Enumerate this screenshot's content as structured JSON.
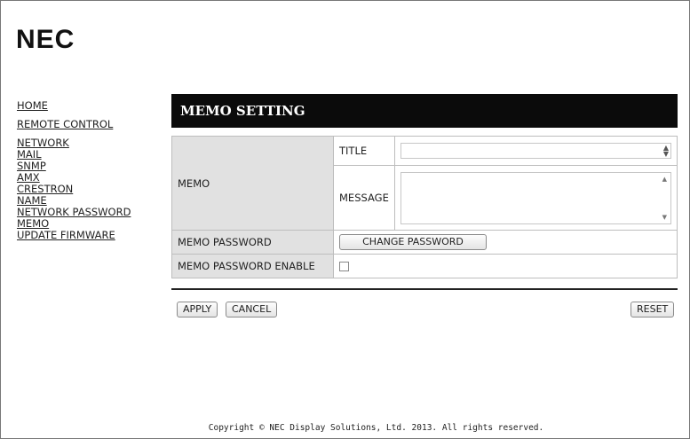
{
  "brand": "NEC",
  "nav": [
    {
      "label": "HOME"
    },
    {
      "label": "REMOTE CONTROL"
    },
    {
      "label": "NETWORK"
    },
    {
      "label": "MAIL"
    },
    {
      "label": "SNMP"
    },
    {
      "label": "AMX"
    },
    {
      "label": "CRESTRON"
    },
    {
      "label": "NAME"
    },
    {
      "label": "NETWORK PASSWORD"
    },
    {
      "label": "MEMO"
    },
    {
      "label": "UPDATE FIRMWARE"
    }
  ],
  "section_title": "MEMO SETTING",
  "settings": {
    "memo_label": "MEMO",
    "title_label": "TITLE",
    "title_value": "",
    "message_label": "MESSAGE",
    "message_value": "",
    "password_label": "MEMO PASSWORD",
    "change_password_button": "CHANGE PASSWORD",
    "password_enable_label": "MEMO PASSWORD ENABLE",
    "password_enable_checked": false
  },
  "actions": {
    "apply": "APPLY",
    "cancel": "CANCEL",
    "reset": "RESET"
  },
  "footer": "Copyright © NEC Display Solutions, Ltd. 2013. All rights reserved."
}
